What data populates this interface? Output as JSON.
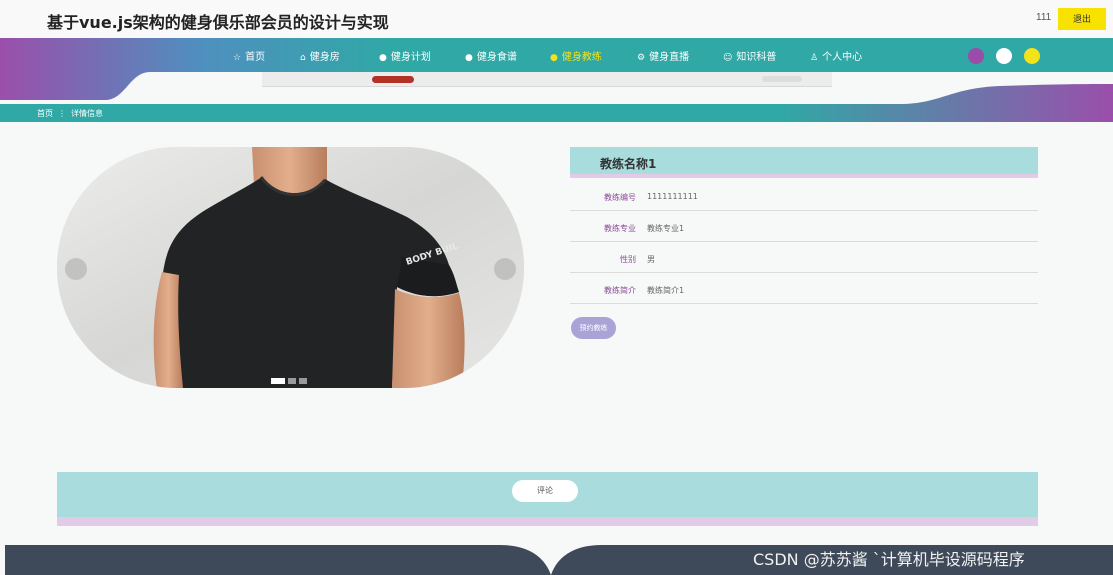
{
  "header": {
    "site_title": "基于vue.js架构的健身俱乐部会员的设计与实现",
    "user_name": "111",
    "logout_label": "退出"
  },
  "nav": {
    "items": [
      {
        "icon": "star-icon",
        "glyph": "☆",
        "label": "首页",
        "active": false
      },
      {
        "icon": "home-icon",
        "glyph": "⌂",
        "label": "健身房",
        "active": false
      },
      {
        "icon": "bullet-icon",
        "glyph": "●",
        "label": "健身计划",
        "active": false
      },
      {
        "icon": "bullet-icon",
        "glyph": "●",
        "label": "健身食谱",
        "active": false
      },
      {
        "icon": "bullet-icon",
        "glyph": "●",
        "label": "健身教练",
        "active": true
      },
      {
        "icon": "settings-icon",
        "glyph": "⚙",
        "label": "健身直播",
        "active": false
      },
      {
        "icon": "smile-icon",
        "glyph": "☺",
        "label": "知识科普",
        "active": false
      },
      {
        "icon": "user-icon",
        "glyph": "♙",
        "label": "个人中心",
        "active": false
      }
    ],
    "active_color": "#f4e21b",
    "theme_dots": [
      {
        "name": "purple",
        "color": "#9b4ca8"
      },
      {
        "name": "white",
        "color": "#ffffff"
      },
      {
        "name": "yellow",
        "color": "#f4e21b"
      }
    ],
    "gradient": {
      "from": "#9a4fab",
      "to": "#30a8a6"
    }
  },
  "breadcrumb": {
    "home": "首页",
    "separator": "⋮",
    "current": "详情信息"
  },
  "gallery": {
    "shirt_text": "BODY BUIL",
    "slide_count": 3,
    "active_slide": 1
  },
  "detail": {
    "title": "教练名称1",
    "fields": [
      {
        "label": "教练编号",
        "value": "1111111111"
      },
      {
        "label": "教练专业",
        "value": "教练专业1"
      },
      {
        "label": "性别",
        "value": "男"
      },
      {
        "label": "教练简介",
        "value": "教练简介1"
      }
    ],
    "book_label": "预约教练"
  },
  "comment": {
    "button_label": "评论"
  },
  "watermark": "CSDN @苏苏酱 `计算机毕设源码程序",
  "colors": {
    "accent_teal": "#a8dcdd",
    "accent_lilac": "#e2cbe6",
    "footer": "#3e4959",
    "book_button": "#a9a3d6",
    "logout_button": "#f7e200"
  }
}
